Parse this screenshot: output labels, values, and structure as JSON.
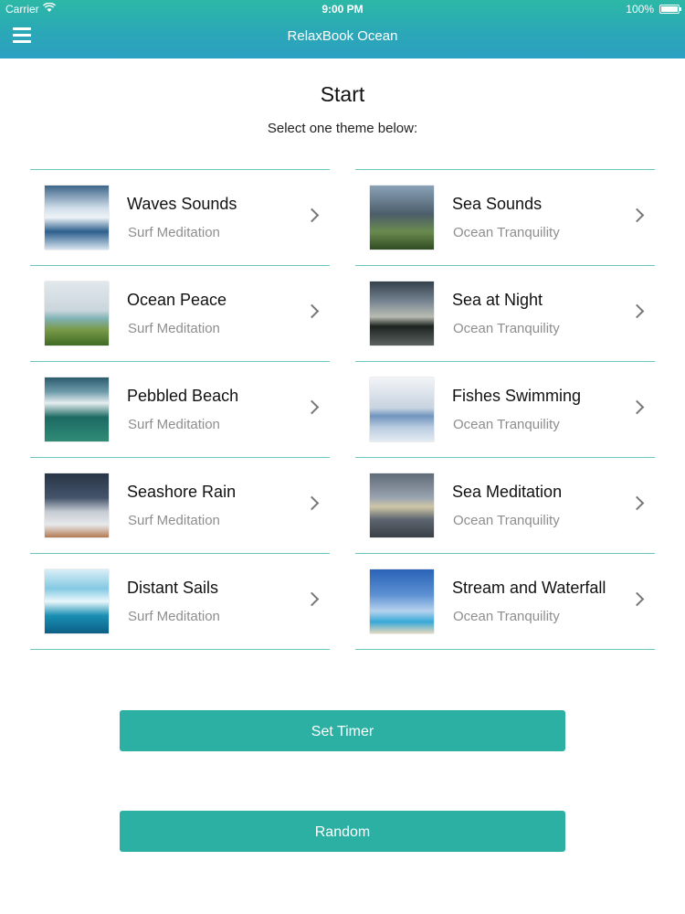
{
  "status_bar": {
    "carrier": "Carrier",
    "time": "9:00 PM",
    "battery": "100%"
  },
  "navbar": {
    "title": "RelaxBook Ocean",
    "menu_icon": "hamburger-menu-icon"
  },
  "page": {
    "title": "Start",
    "subtitle": "Select one theme below:"
  },
  "themes_left": [
    {
      "title": "Waves Sounds",
      "subtitle": "Surf Meditation"
    },
    {
      "title": "Ocean Peace",
      "subtitle": "Surf Meditation"
    },
    {
      "title": "Pebbled Beach",
      "subtitle": "Surf Meditation"
    },
    {
      "title": "Seashore Rain",
      "subtitle": "Surf Meditation"
    },
    {
      "title": "Distant Sails",
      "subtitle": "Surf Meditation"
    }
  ],
  "themes_right": [
    {
      "title": "Sea Sounds",
      "subtitle": "Ocean Tranquility"
    },
    {
      "title": "Sea at Night",
      "subtitle": "Ocean Tranquility"
    },
    {
      "title": "Fishes Swimming",
      "subtitle": "Ocean Tranquility"
    },
    {
      "title": "Sea Meditation",
      "subtitle": "Ocean Tranquility"
    },
    {
      "title": "Stream and Waterfall",
      "subtitle": "Ocean Tranquility"
    }
  ],
  "buttons": {
    "set_timer": "Set Timer",
    "random": "Random"
  },
  "colors": {
    "accent": "#2db0a4",
    "header_start": "#2cb8a6",
    "header_end": "#2d9fc2",
    "divider": "#6cc6c0",
    "subtitle_gray": "#8e8e8e"
  }
}
